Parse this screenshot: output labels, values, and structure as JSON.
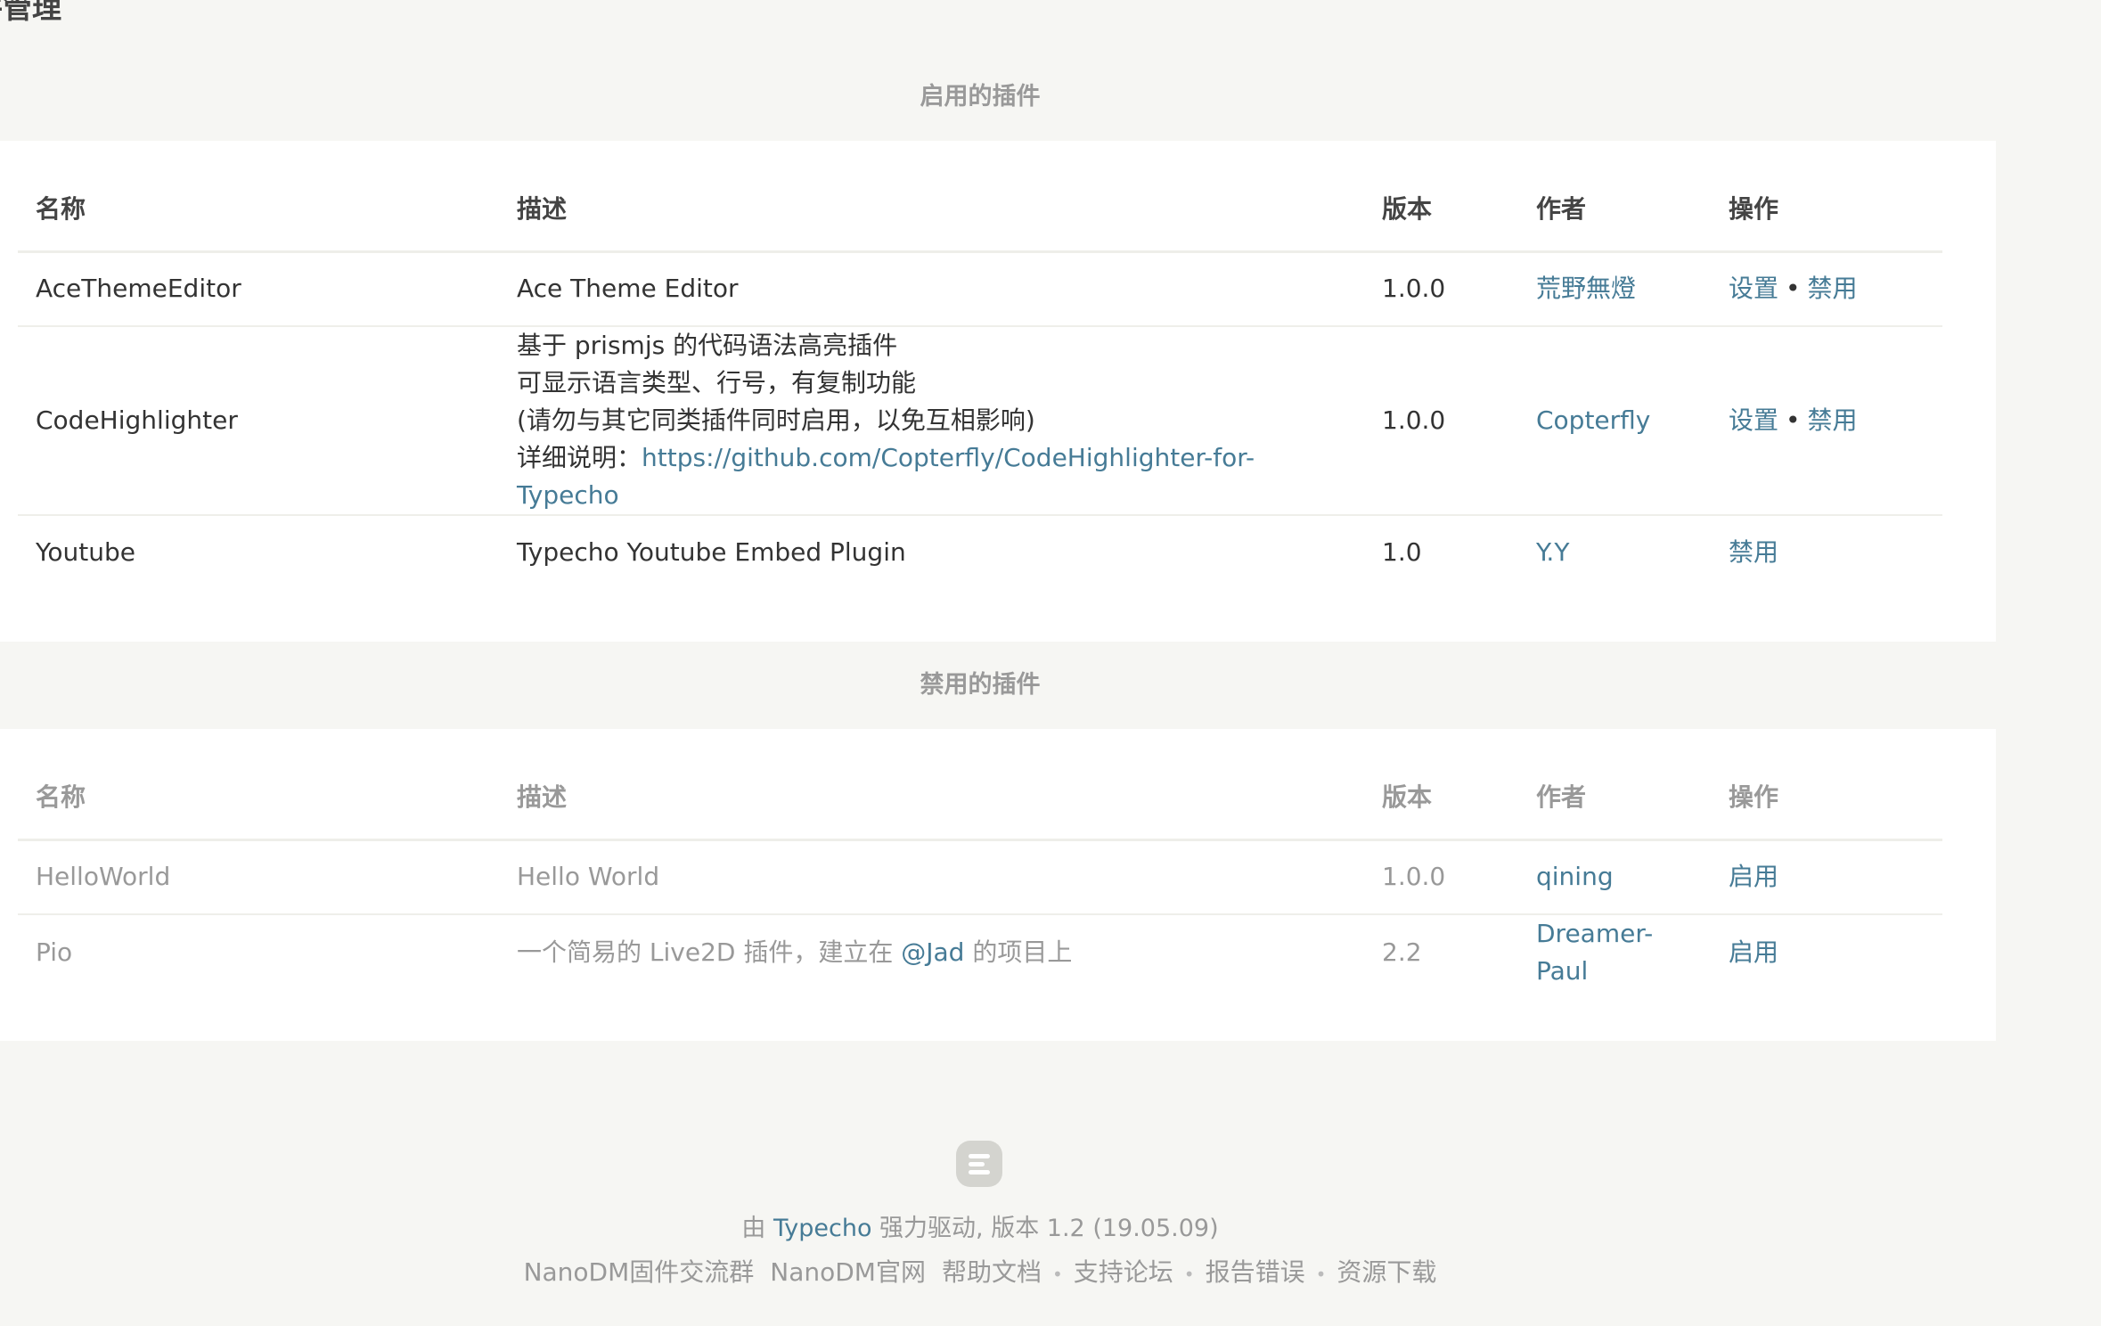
{
  "page": {
    "title": "件管理"
  },
  "enabled": {
    "section_title": "启用的插件",
    "headers": [
      "名称",
      "描述",
      "版本",
      "作者",
      "操作"
    ],
    "rows": [
      {
        "name": "AceThemeEditor",
        "desc": [
          "Ace Theme Editor"
        ],
        "version": "1.0.0",
        "author": "荒野無燈",
        "actions": [
          "设置",
          "禁用"
        ]
      },
      {
        "name": "CodeHighlighter",
        "desc": [
          "基于 prismjs 的代码语法高亮插件",
          "可显示语言类型、行号，有复制功能",
          "(请勿与其它同类插件同时启用，以免互相影响)"
        ],
        "desc_link_prefix": "详细说明：",
        "desc_link": "https://github.com/Copterfly/CodeHighlighter-for-Typecho",
        "version": "1.0.0",
        "author": "Copterfly",
        "actions": [
          "设置",
          "禁用"
        ]
      },
      {
        "name": "Youtube",
        "desc": [
          "Typecho Youtube Embed Plugin"
        ],
        "version": "1.0",
        "author": "Y.Y",
        "actions": [
          "禁用"
        ]
      }
    ]
  },
  "disabled": {
    "section_title": "禁用的插件",
    "headers": [
      "名称",
      "描述",
      "版本",
      "作者",
      "操作"
    ],
    "rows": [
      {
        "name": "HelloWorld",
        "desc": "Hello World",
        "version": "1.0.0",
        "author": "qining",
        "action": "启用"
      },
      {
        "name": "Pio",
        "desc_before": "一个简易的 Live2D 插件，建立在 ",
        "desc_link": "@Jad",
        "desc_after": " 的项目上",
        "version": "2.2",
        "author": "Dreamer-Paul",
        "action": "启用"
      }
    ]
  },
  "footer": {
    "powered_prefix": "由 ",
    "powered_link": "Typecho",
    "powered_suffix": " 强力驱动, 版本 1.2 (19.05.09)",
    "links": [
      "NanoDM固件交流群",
      "NanoDM官网",
      "帮助文档",
      "支持论坛",
      "报告错误",
      "资源下载"
    ]
  }
}
